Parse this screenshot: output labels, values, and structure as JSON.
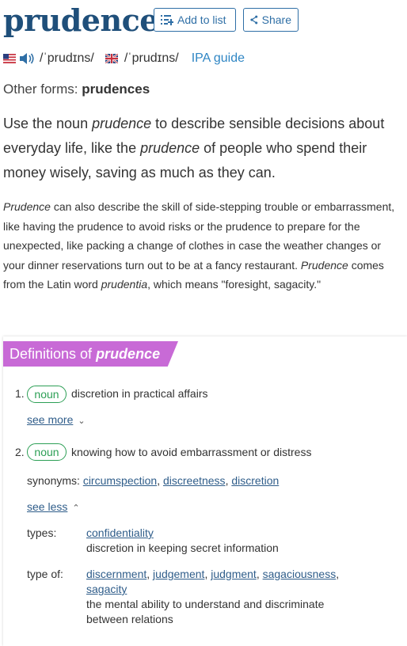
{
  "word": "prudence",
  "actions": {
    "add_to_list": "Add to list",
    "share": "Share"
  },
  "pronunciation": {
    "us": "/ˈprudɪns/",
    "uk": "/ˈprudɪns/",
    "ipa_guide": "IPA guide"
  },
  "other_forms": {
    "label": "Other forms:",
    "value": "prudences"
  },
  "short_desc": [
    "Use the noun ",
    "prudence",
    " to describe sensible decisions about everyday life, like the ",
    "prudence",
    " of people who spend their money wisely, saving as much as they can."
  ],
  "long_desc": [
    "Prudence",
    " can also describe the skill of side-stepping trouble or embarrassment, like having the prudence to avoid risks or the prudence to prepare for the unexpected, like packing a change of clothes in case the weather changes or your dinner reservations turn out to be at a fancy restaurant. ",
    "Prudence",
    " comes from the Latin word ",
    "prudentia",
    ", which means \"foresight, sagacity.\""
  ],
  "definitions": {
    "title_prefix": "Definitions of ",
    "title_word": "prudence",
    "items": [
      {
        "num": "1.",
        "pos": "noun",
        "text": "discretion in practical affairs",
        "see_more": "see more"
      },
      {
        "num": "2.",
        "pos": "noun",
        "text": "knowing how to avoid embarrassment or distress",
        "synonyms_label": "synonyms:",
        "synonyms": [
          "circumspection",
          "discreetness",
          "discretion"
        ],
        "see_less": "see less",
        "types_label": "types:",
        "types_links": [
          "confidentiality"
        ],
        "types_desc": "discretion in keeping secret information",
        "typeof_label": "type of:",
        "typeof_links": [
          "discernment",
          "judgement",
          "judgment",
          "sagaciousness",
          "sagacity"
        ],
        "typeof_desc": "the mental ability to understand and discriminate between relations"
      }
    ]
  },
  "colors": {
    "word": "#1f4f7a",
    "button": "#2f6fa6",
    "banner": "#c86ad6",
    "pill": "#2c9f55",
    "link": "#2f5d8a"
  }
}
